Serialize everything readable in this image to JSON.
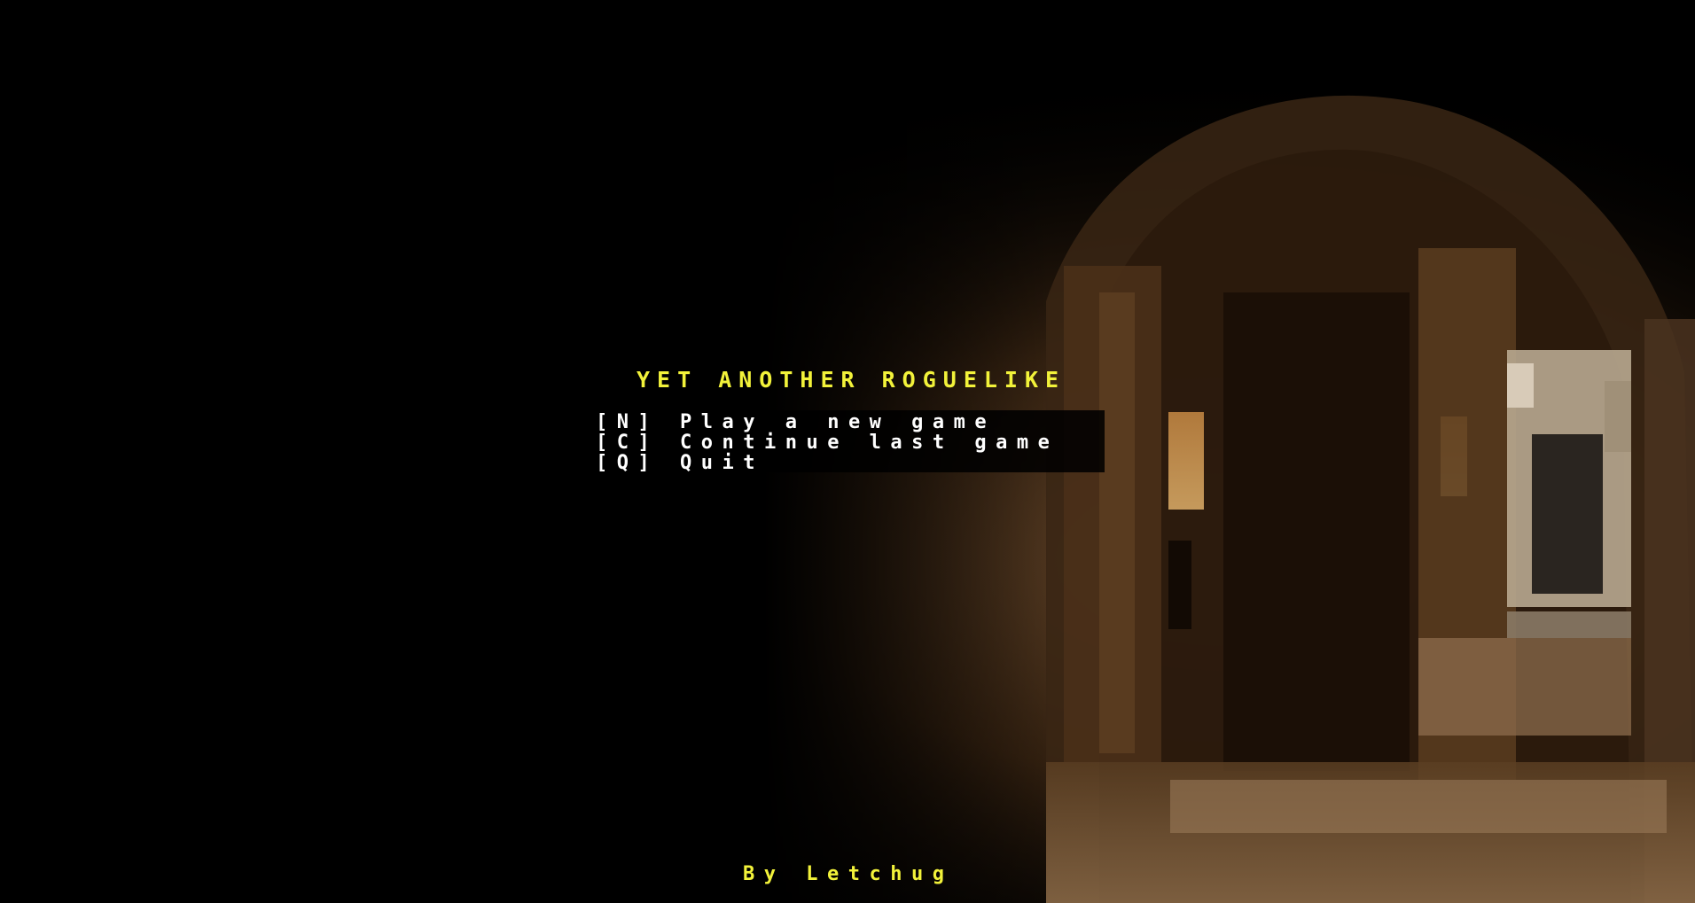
{
  "title": "YET ANOTHER ROGUELIKE",
  "menu": [
    {
      "key": "[N]",
      "label": "Play a new game",
      "text": "[N] Play a new game"
    },
    {
      "key": "[C]",
      "label": "Continue last game",
      "text": "[C] Continue last game"
    },
    {
      "key": "[Q]",
      "label": "Quit",
      "text": "[Q] Quit"
    }
  ],
  "credit": "By Letchug",
  "colors": {
    "background": "#000000",
    "title": "#f2f23a",
    "menu_text": "#ffffff",
    "credit": "#f2f23a",
    "scene_brown_dark": "#2a1a0c",
    "scene_brown_mid": "#6b4a2c",
    "scene_brown_light": "#a07c58",
    "torch_glow": "#d9a25a"
  },
  "background_art": "pixelated-dungeon-corridor"
}
